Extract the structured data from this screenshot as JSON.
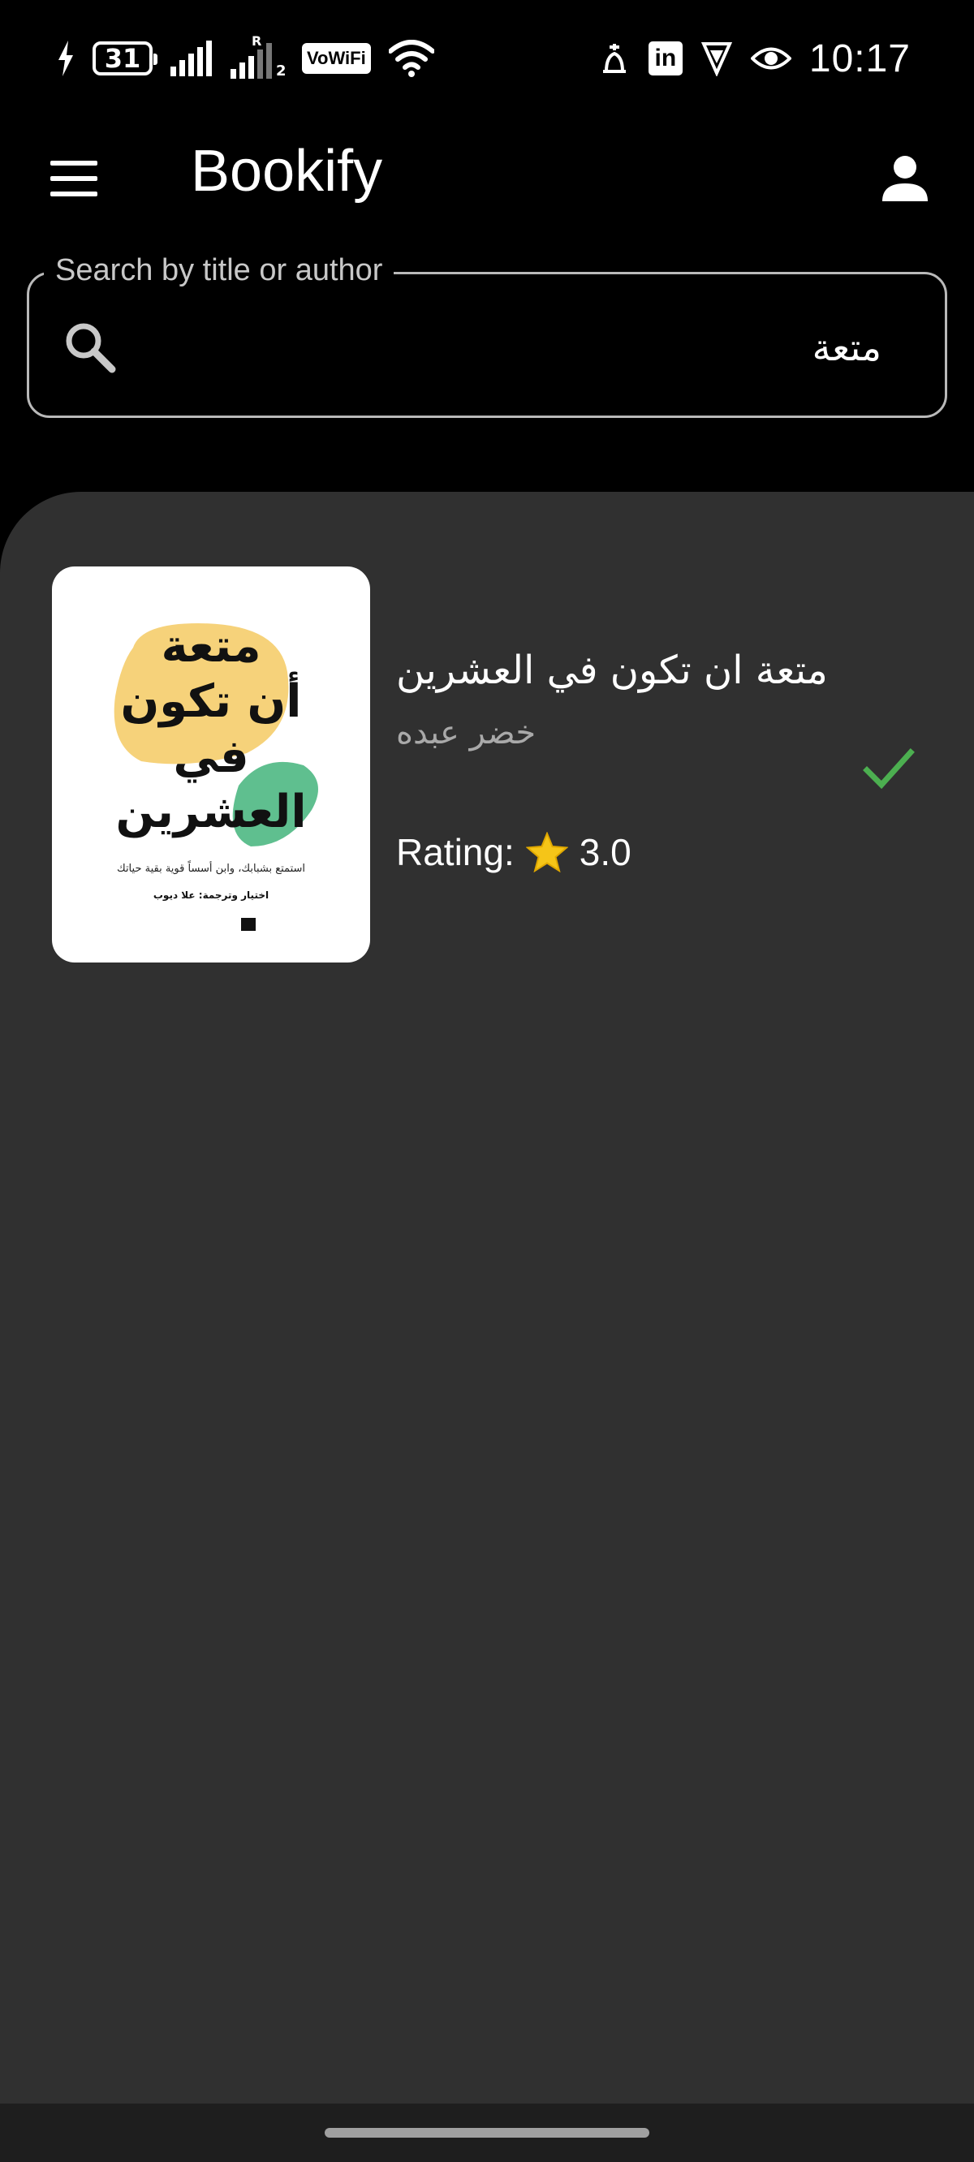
{
  "status_bar": {
    "battery_level": "31",
    "wifi_calling_label": "VoWiFi",
    "signal_roaming_label": "R",
    "sim_slot_label": "2",
    "time": "10:17",
    "icons": [
      "charging-icon",
      "battery-icon",
      "signal-icon",
      "signal-roaming-icon",
      "vowifi-icon",
      "wifi-icon",
      "notification-icon",
      "linkedin-icon",
      "vpn-icon",
      "eye-icon"
    ]
  },
  "app_bar": {
    "title": "Bookify",
    "menu_icon": "menu-icon",
    "account_icon": "account-icon"
  },
  "search": {
    "label": "Search by title or author",
    "value": "متعة",
    "icon": "search-icon"
  },
  "results": [
    {
      "title": "متعة ان تكون في العشرين",
      "author": "خضر عبده",
      "rating_label": "Rating:",
      "rating_value": "3.0",
      "read_status_icon": "check-icon",
      "cover": {
        "title_lines": [
          "متعة",
          "أن تكون",
          "في",
          "العشرين"
        ],
        "subtitle": "استمتع بشبابك، وابن أسساً قوية بقية حياتك",
        "credit": "اختيار وترجمة: علا ديوب",
        "blob_colors": [
          "#f6d27a",
          "#5fbf8f"
        ]
      }
    }
  ],
  "colors": {
    "background": "#000000",
    "sheet": "#303030",
    "check": "#4caf50",
    "star": "#f5c518",
    "secondary_text": "#a9a9a9"
  }
}
